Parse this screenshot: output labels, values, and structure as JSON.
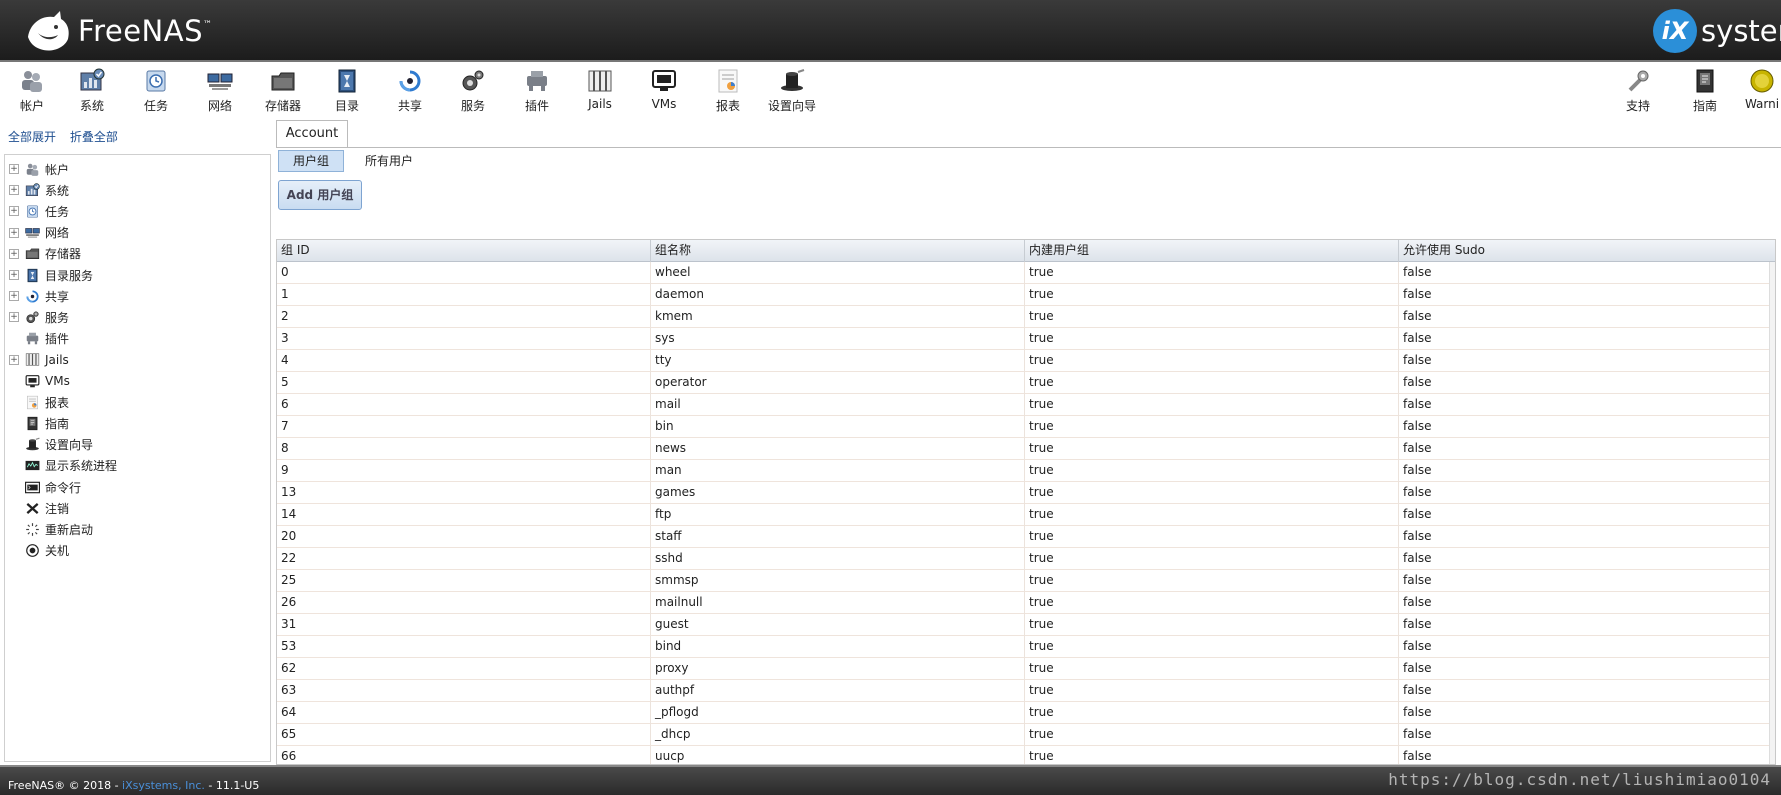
{
  "header": {
    "logo_text": "FreeNAS",
    "logo_tm": "™",
    "brand_badge": "iX",
    "brand_text": "systems"
  },
  "toolbar": {
    "items": [
      {
        "label": "帐户",
        "icon": "users-icon"
      },
      {
        "label": "系统",
        "icon": "system-icon"
      },
      {
        "label": "任务",
        "icon": "tasks-icon"
      },
      {
        "label": "网络",
        "icon": "network-icon"
      },
      {
        "label": "存储器",
        "icon": "storage-icon"
      },
      {
        "label": "目录",
        "icon": "directory-icon"
      },
      {
        "label": "共享",
        "icon": "sharing-icon"
      },
      {
        "label": "服务",
        "icon": "services-icon"
      },
      {
        "label": "插件",
        "icon": "plugins-icon"
      },
      {
        "label": "Jails",
        "icon": "jails-icon"
      },
      {
        "label": "VMs",
        "icon": "vms-icon"
      },
      {
        "label": "报表",
        "icon": "reporting-icon"
      },
      {
        "label": "设置向导",
        "icon": "wizard-icon"
      }
    ],
    "right_items": [
      {
        "label": "支持",
        "icon": "support-icon"
      },
      {
        "label": "指南",
        "icon": "guide-icon"
      },
      {
        "label": "Warni",
        "icon": "warning-icon"
      }
    ]
  },
  "sidebar": {
    "expand_all": "全部展开",
    "collapse_all": "折叠全部",
    "items": [
      {
        "label": "帐户",
        "expandable": true,
        "icon": "users-icon"
      },
      {
        "label": "系统",
        "expandable": true,
        "icon": "system-icon"
      },
      {
        "label": "任务",
        "expandable": true,
        "icon": "tasks-icon"
      },
      {
        "label": "网络",
        "expandable": true,
        "icon": "network-icon"
      },
      {
        "label": "存储器",
        "expandable": true,
        "icon": "storage-icon"
      },
      {
        "label": "目录服务",
        "expandable": true,
        "icon": "directory-icon"
      },
      {
        "label": "共享",
        "expandable": true,
        "icon": "sharing-icon"
      },
      {
        "label": "服务",
        "expandable": true,
        "icon": "services-icon"
      },
      {
        "label": "插件",
        "expandable": false,
        "icon": "plugins-icon"
      },
      {
        "label": "Jails",
        "expandable": true,
        "icon": "jails-icon"
      },
      {
        "label": "VMs",
        "expandable": false,
        "icon": "vms-icon"
      },
      {
        "label": "报表",
        "expandable": false,
        "icon": "reporting-icon"
      },
      {
        "label": "指南",
        "expandable": false,
        "icon": "guide-icon"
      },
      {
        "label": "设置向导",
        "expandable": false,
        "icon": "wizard-icon"
      },
      {
        "label": "显示系统进程",
        "expandable": false,
        "icon": "process-icon"
      },
      {
        "label": "命令行",
        "expandable": false,
        "icon": "shell-icon"
      },
      {
        "label": "注销",
        "expandable": false,
        "icon": "logout-icon"
      },
      {
        "label": "重新启动",
        "expandable": false,
        "icon": "reboot-icon"
      },
      {
        "label": "关机",
        "expandable": false,
        "icon": "shutdown-icon"
      }
    ]
  },
  "main": {
    "tab_label": "Account",
    "subtabs": [
      "用户组",
      "所有用户"
    ],
    "add_button": "Add 用户组",
    "table": {
      "columns": [
        "组 ID",
        "组名称",
        "内建用户组",
        "允许使用 Sudo"
      ],
      "rows": [
        [
          "0",
          "wheel",
          "true",
          "false"
        ],
        [
          "1",
          "daemon",
          "true",
          "false"
        ],
        [
          "2",
          "kmem",
          "true",
          "false"
        ],
        [
          "3",
          "sys",
          "true",
          "false"
        ],
        [
          "4",
          "tty",
          "true",
          "false"
        ],
        [
          "5",
          "operator",
          "true",
          "false"
        ],
        [
          "6",
          "mail",
          "true",
          "false"
        ],
        [
          "7",
          "bin",
          "true",
          "false"
        ],
        [
          "8",
          "news",
          "true",
          "false"
        ],
        [
          "9",
          "man",
          "true",
          "false"
        ],
        [
          "13",
          "games",
          "true",
          "false"
        ],
        [
          "14",
          "ftp",
          "true",
          "false"
        ],
        [
          "20",
          "staff",
          "true",
          "false"
        ],
        [
          "22",
          "sshd",
          "true",
          "false"
        ],
        [
          "25",
          "smmsp",
          "true",
          "false"
        ],
        [
          "26",
          "mailnull",
          "true",
          "false"
        ],
        [
          "31",
          "guest",
          "true",
          "false"
        ],
        [
          "53",
          "bind",
          "true",
          "false"
        ],
        [
          "62",
          "proxy",
          "true",
          "false"
        ],
        [
          "63",
          "authpf",
          "true",
          "false"
        ],
        [
          "64",
          "_pflogd",
          "true",
          "false"
        ],
        [
          "65",
          "_dhcp",
          "true",
          "false"
        ],
        [
          "66",
          "uucp",
          "true",
          "false"
        ]
      ]
    }
  },
  "footer": {
    "prefix": "FreeNAS® © 2018 - ",
    "company": "iXsystems, Inc.",
    "version": " - 11.1-U5",
    "watermark": "https://blog.csdn.net/liushimiao0104"
  },
  "colors": {
    "header_bg": "#1c1c1c",
    "brand_blue": "#2b8fd8",
    "link_blue": "#1f4f90",
    "active_subtab": "#cfe1f5"
  }
}
